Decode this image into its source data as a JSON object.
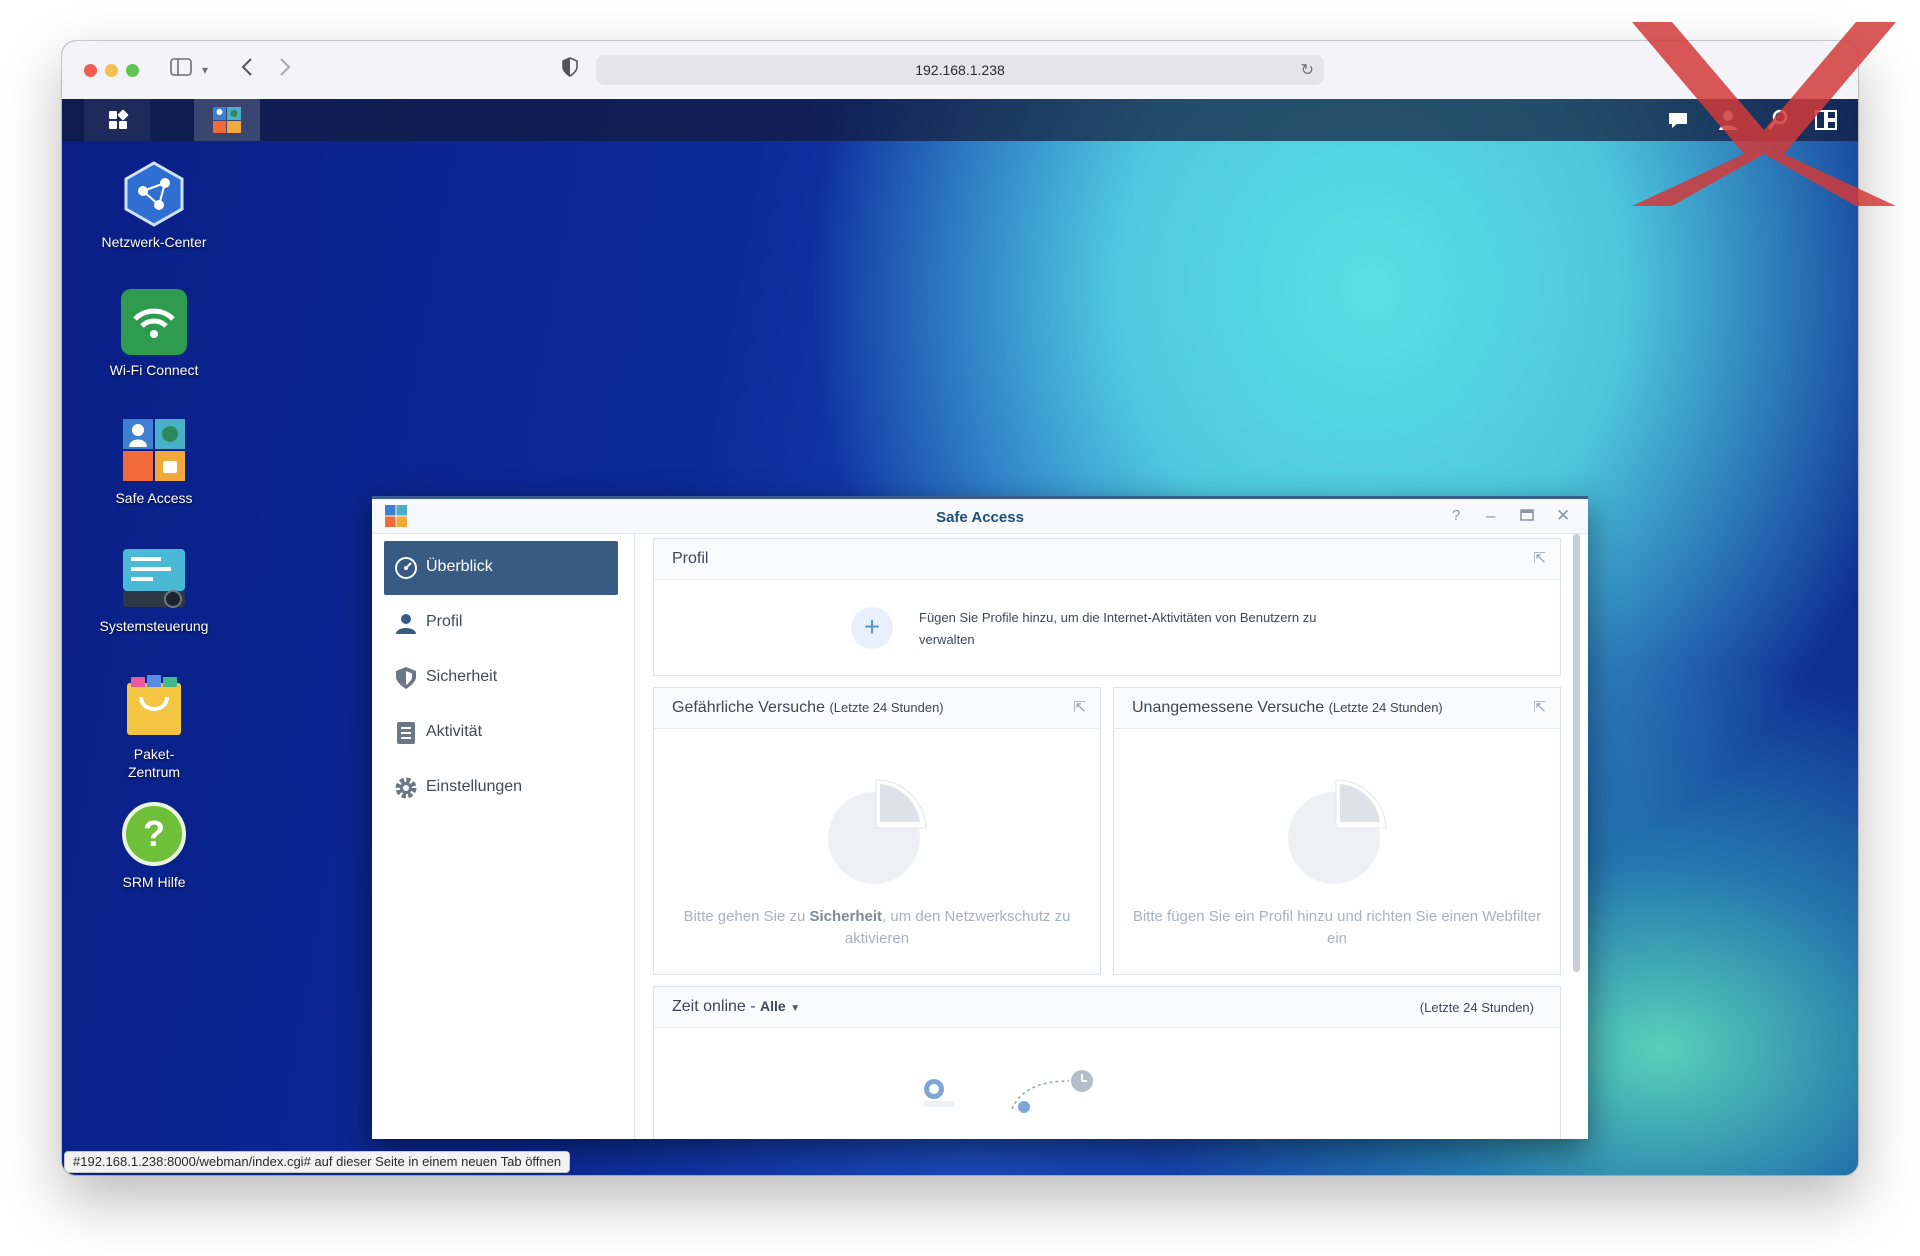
{
  "browser": {
    "url": "192.168.1.238",
    "status_hint": "#192.168.1.238:8000/webman/index.cgi# auf dieser Seite in einem neuen Tab öffnen"
  },
  "taskbar": {
    "main_menu_icon": "grid-icon",
    "open_app_icon": "safe-access-icon",
    "tray_icons": [
      "chat-icon",
      "user-icon",
      "search-icon",
      "widgets-icon"
    ]
  },
  "desktop": {
    "icons": [
      {
        "label": "Netzwerk-Center",
        "icon": "network-center-icon"
      },
      {
        "label": "Wi-Fi Connect",
        "icon": "wifi-icon"
      },
      {
        "label": "Safe Access",
        "icon": "safe-access-icon"
      },
      {
        "label": "Systemsteuerung",
        "icon": "control-panel-icon"
      },
      {
        "label": "Paket-\nZentrum",
        "icon": "package-center-icon"
      },
      {
        "label": "SRM Hilfe",
        "icon": "help-icon"
      }
    ]
  },
  "window": {
    "title": "Safe Access",
    "controls": [
      "help-icon",
      "minimize-icon",
      "maximize-icon",
      "close-icon"
    ],
    "nav": [
      {
        "label": "Überblick",
        "icon": "dashboard-icon",
        "active": true
      },
      {
        "label": "Profil",
        "icon": "user-icon",
        "active": false
      },
      {
        "label": "Sicherheit",
        "icon": "shield-icon",
        "active": false
      },
      {
        "label": "Aktivität",
        "icon": "list-icon",
        "active": false
      },
      {
        "label": "Einstellungen",
        "icon": "gear-icon",
        "active": false
      }
    ],
    "profil_card": {
      "title": "Profil",
      "message": "Fügen Sie Profile hinzu, um die Internet-Aktivitäten von Benutzern zu verwalten"
    },
    "dangerous_card": {
      "title": "Gefährliche Versuche",
      "subtitle": "(Letzte 24 Stunden)",
      "msg_before": "Bitte gehen Sie zu ",
      "msg_bold": "Sicherheit",
      "msg_after": ", um den Netzwerkschutz zu aktivieren"
    },
    "inappropriate_card": {
      "title": "Unangemessene Versuche",
      "subtitle": "(Letzte 24 Stunden)",
      "message": "Bitte fügen Sie ein Profil hinzu und richten Sie einen Webfilter ein"
    },
    "online_card": {
      "title": "Zeit online -",
      "filter": "Alle",
      "range": "(Letzte 24 Stunden)"
    }
  },
  "colors": {
    "nav_active": "#385b83",
    "window_title": "#1d4f7f",
    "desktop_blue": "#0b2a8f",
    "desktop_cyan": "#5ce8e8"
  }
}
